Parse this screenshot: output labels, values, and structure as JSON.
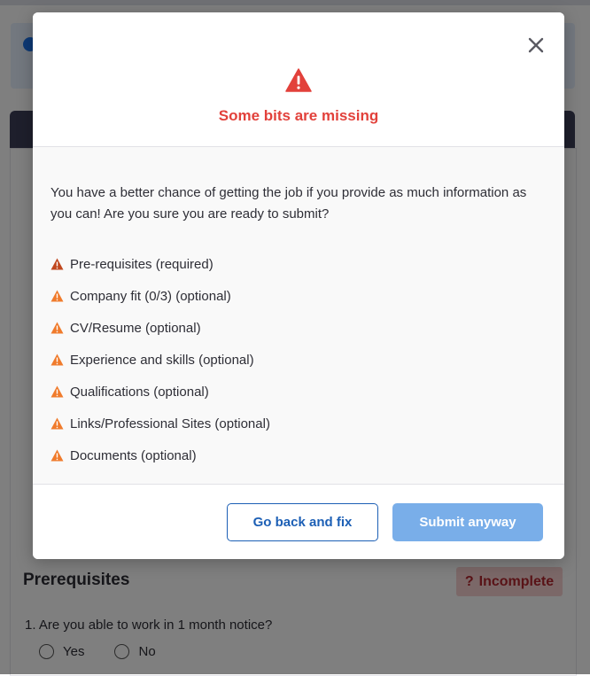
{
  "background": {
    "section_title": "Prerequisites",
    "status_badge": {
      "icon": "question-icon",
      "label": "Incomplete"
    },
    "question": "1. Are you able to work in 1 month notice?",
    "options": [
      "Yes",
      "No"
    ]
  },
  "modal": {
    "close_icon": "close-icon",
    "warning_icon": "warning-triangle-icon",
    "title": "Some bits are missing",
    "intro": "You have a better chance of getting the job if you provide as much information as you can! Are you sure you are ready to submit?",
    "items": [
      {
        "label": "Pre-requisites (required)",
        "severity": "required"
      },
      {
        "label": "Company fit (0/3) (optional)",
        "severity": "optional"
      },
      {
        "label": "CV/Resume (optional)",
        "severity": "optional"
      },
      {
        "label": "Experience and skills (optional)",
        "severity": "optional"
      },
      {
        "label": "Qualifications (optional)",
        "severity": "optional"
      },
      {
        "label": "Links/Professional Sites (optional)",
        "severity": "optional"
      },
      {
        "label": "Documents (optional)",
        "severity": "optional"
      }
    ],
    "buttons": {
      "back": "Go back and fix",
      "submit": "Submit anyway"
    }
  },
  "colors": {
    "title_red": "#e2413b",
    "required_warning": "#c0471e",
    "optional_warning": "#f07b2c",
    "primary_blue": "#1c5fb5",
    "submit_disabled_blue": "#79aee9",
    "badge_bg": "#f6d1d1"
  }
}
